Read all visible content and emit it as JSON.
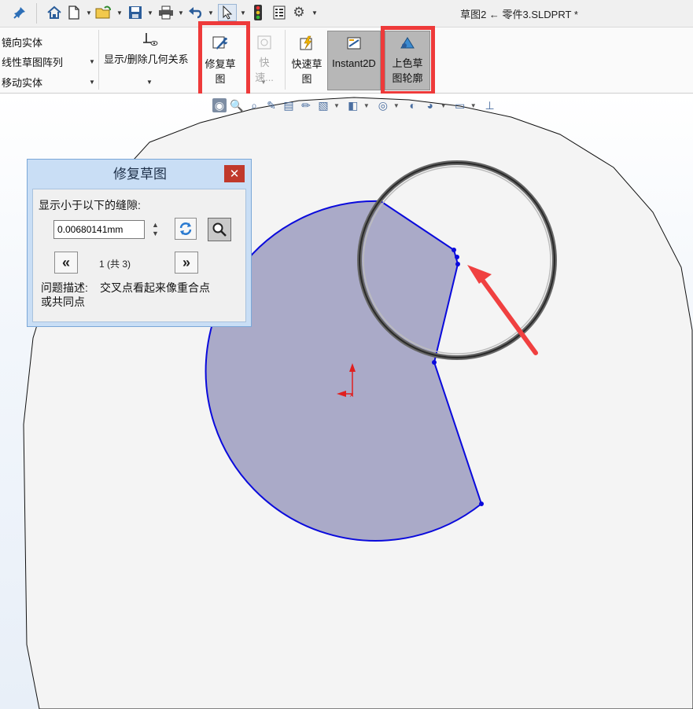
{
  "toolbar": {
    "pin_icon": "pin-icon",
    "items": [
      "home-icon",
      "new-file-icon",
      "open-icon",
      "save-icon",
      "print-icon",
      "undo-icon",
      "select-icon",
      "traffic-light-icon",
      "file-properties-icon",
      "gear-icon"
    ]
  },
  "document_title": "草图2 ← 零件3.SLDPRT *",
  "ribbon": {
    "mirror": "镜向实体",
    "linear_pattern": "线性草图阵列",
    "move": "移动实体",
    "relations": "显示/删除几何关系",
    "repair": {
      "line1": "修复草",
      "line2": "图"
    },
    "quick_snap": "快速...",
    "rapid_sketch": {
      "line1": "快速草",
      "line2": "图"
    },
    "instant2d": "Instant2D",
    "shaded": {
      "line1": "上色草",
      "line2": "图轮廓"
    }
  },
  "dialog": {
    "title": "修复草图",
    "close": "✕",
    "gap_label": "显示小于以下的缝隙:",
    "gap_value": "0.00680141mm",
    "prev": "«",
    "next": "»",
    "counter": "1 (共 3)",
    "problem_label": "问题描述:",
    "problem_text": "交叉点看起来像重合点",
    "problem_text2": "或共同点"
  },
  "colors": {
    "highlight_box": "#ee3a3a",
    "sketch_line": "#0a0adc",
    "sketch_fill": "#aaaac8",
    "dialog_frame": "#c9def5",
    "close_button": "#c0392b"
  }
}
